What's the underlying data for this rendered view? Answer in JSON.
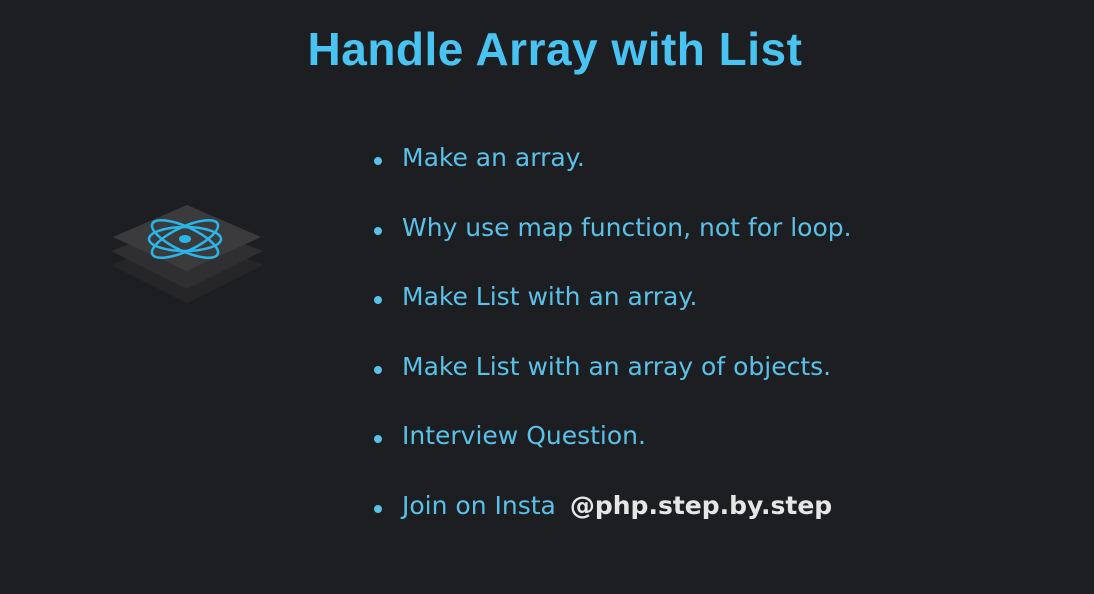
{
  "title": "Handle Array with List",
  "logo": {
    "icon": "react-atom-icon",
    "accent": "#29b6e8"
  },
  "items": [
    {
      "text": "Make an array."
    },
    {
      "text": "Why use map function, not for loop."
    },
    {
      "text": "Make List with an array."
    },
    {
      "text": "Make List with an array of objects."
    },
    {
      "text": "Interview Question."
    },
    {
      "text": "Join on Insta",
      "handle": "@php.step.by.step"
    }
  ],
  "colors": {
    "background": "#1d1e21",
    "title": "#49c3f2",
    "text": "#5ac1e8",
    "handle": "#e6e6e6"
  }
}
